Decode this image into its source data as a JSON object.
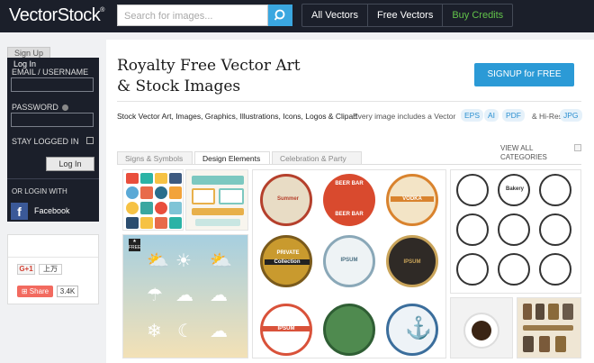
{
  "header": {
    "logo": "VectorStock",
    "logo_mark": "®",
    "search_placeholder": "Search for images...",
    "nav": [
      "All Vectors",
      "Free Vectors",
      "Buy Credits"
    ]
  },
  "login": {
    "tab_signup": "Sign Up",
    "tab_login": "Log In",
    "email_label": "EMAIL / USERNAME",
    "password_label": "PASSWORD",
    "stay_logged_in": "STAY LOGGED IN",
    "login_button": "Log In",
    "or_login_with": "OR LOGIN WITH",
    "facebook": "Facebook"
  },
  "share": {
    "gplus_label": "G+1",
    "gplus_count": "上万",
    "share_label": "Share",
    "share_count": "3.4K"
  },
  "main": {
    "title_line1": "Royalty Free Vector Art",
    "title_line2": "& Stock Images",
    "signup_button": "SIGNUP for FREE",
    "subline": "Stock Vector Art, Images, Graphics, Illustrations, Icons, Logos & Clipart",
    "subline2": "Every image includes a Vector",
    "formats": [
      "EPS",
      "AI",
      "PDF"
    ],
    "hires_text": "& Hi-Res",
    "format_jpg": "JPG",
    "tabs": [
      "Signs & Symbols",
      "Design Elements",
      "Celebration & Party"
    ],
    "active_tab": "Design Elements",
    "view_all_line1": "VIEW ALL",
    "view_all_line2": "CATEGORIES"
  },
  "thumb_text": {
    "beer1": "BEER BAR",
    "beer2": "BEER BAR",
    "surfing": "Summer",
    "vodka": "VODKA",
    "private": "PRIVATE",
    "collection": "Collection",
    "ipsum1": "IPSUM",
    "ipsum2": "IPSUM",
    "ipsum3": "IPSUM",
    "bakery": "Bakery",
    "free": "FREE"
  },
  "colors": {
    "topbar": "#1b1f2a",
    "accent_blue": "#2b9ad6",
    "buy_green": "#62c34a",
    "facebook": "#3b5998"
  }
}
